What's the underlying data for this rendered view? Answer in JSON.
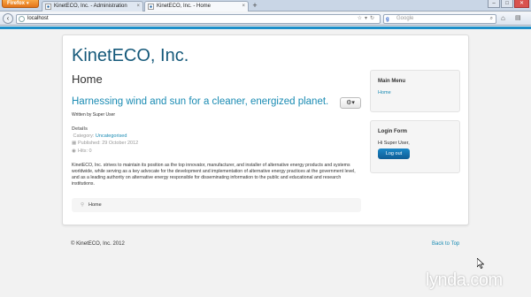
{
  "browser": {
    "menu_button": "Firefox",
    "tabs": [
      {
        "title": "KinetECO, Inc. - Administration"
      },
      {
        "title": "KinetECO, Inc. - Home"
      }
    ],
    "new_tab_glyph": "+",
    "address": "localhost",
    "search_placeholder": "Google",
    "window_controls": [
      "–",
      "□",
      "✕"
    ]
  },
  "site": {
    "brand": "KinetECO, Inc.",
    "page_heading": "Home",
    "article": {
      "title": "Harnessing wind and sun for a cleaner, energized planet.",
      "author": "Written by Super User",
      "details_label": "Details",
      "category_label": "Category:",
      "category": "Uncategorised",
      "published": "Published: 29 October 2012",
      "hits": "Hits: 0",
      "intro": "KinetECO, Inc. strives to maintain its position as the top innovator, manufacturer, and installer of alternative energy products and systems worldwide, while serving as a key advocate for the development and implementation of alternative energy practices at the government level, and as a leading authority on alternative energy responsible for disseminating information to the public and educational and research institutions."
    },
    "breadcrumb": "Home",
    "main_menu": {
      "title": "Main Menu",
      "items": [
        "Home"
      ]
    },
    "login_form": {
      "title": "Login Form",
      "greeting": "Hi Super User,",
      "logout_label": "Log out"
    },
    "footer": {
      "copyright": "© KinetECO, Inc. 2012",
      "back_to_top": "Back to Top"
    }
  },
  "watermark": "lynda.com",
  "colors": {
    "accent": "#1e8fc9",
    "link": "#1a8bb3",
    "brand": "#15597a",
    "firefox": "#e3741a"
  }
}
